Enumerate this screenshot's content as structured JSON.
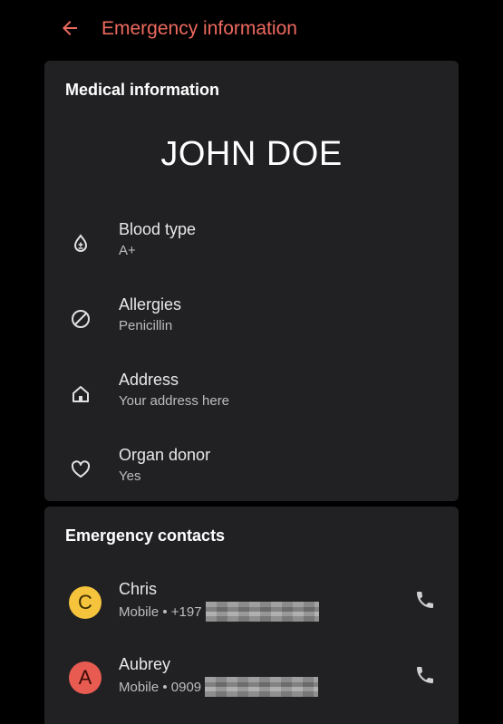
{
  "colors": {
    "accent": "#ee6a5f",
    "background": "#000000",
    "card": "#212124",
    "avatar_chris": "#f6c43c",
    "avatar_aubrey": "#e85b51"
  },
  "topbar": {
    "title": "Emergency information",
    "back_icon": "arrow-left-icon"
  },
  "medical": {
    "header": "Medical information",
    "name": "JOHN DOE",
    "items": [
      {
        "icon": "blood-drop-icon",
        "label": "Blood type",
        "value": "A+"
      },
      {
        "icon": "block-icon",
        "label": "Allergies",
        "value": "Penicillin"
      },
      {
        "icon": "home-icon",
        "label": "Address",
        "value": "Your address here"
      },
      {
        "icon": "heart-icon",
        "label": "Organ donor",
        "value": "Yes"
      }
    ]
  },
  "contacts": {
    "header": "Emergency contacts",
    "items": [
      {
        "initial": "C",
        "name": "Chris",
        "detail": "Mobile • +197",
        "call_icon": "phone-icon"
      },
      {
        "initial": "A",
        "name": "Aubrey",
        "detail": "Mobile • 0909",
        "call_icon": "phone-icon"
      }
    ]
  }
}
